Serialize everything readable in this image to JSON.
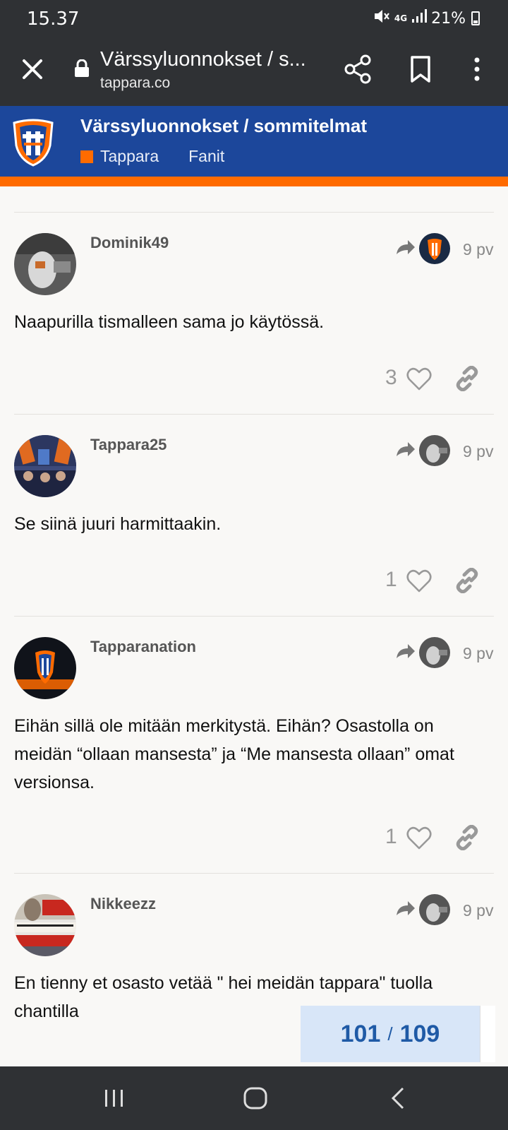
{
  "status_bar": {
    "time": "15.37",
    "network": "4G",
    "battery": "21%"
  },
  "browser": {
    "title": "Värssyluonnokset / s...",
    "domain": "tappara.co"
  },
  "forum": {
    "topic_title": "Värssyluonnokset / sommitelmat",
    "category": "Tappara",
    "subcategory": "Fanit",
    "accent_color": "#ff6b00",
    "header_color": "#1c479b"
  },
  "posts": [
    {
      "username": "Dominik49",
      "date": "9 pv",
      "body": "Naapurilla tismalleen sama jo käytössä.",
      "likes": "3"
    },
    {
      "username": "Tappara25",
      "date": "9 pv",
      "body": "Se siinä juuri harmittaakin.",
      "likes": "1"
    },
    {
      "username": "Tapparanation",
      "date": "9 pv",
      "body": "Eihän sillä ole mitään merkitystä. Eihän? Osastolla on meidän “ollaan mansesta” ja “Me mansesta ollaan” omat versionsa.",
      "likes": "1"
    },
    {
      "username": "Nikkeezz",
      "date": "9 pv",
      "body": "En tienny et osasto vetää \" hei meidän tappara\" tuolla chantilla",
      "likes": ""
    }
  ],
  "progress": {
    "current": "101",
    "separator": "/",
    "total": "109"
  }
}
